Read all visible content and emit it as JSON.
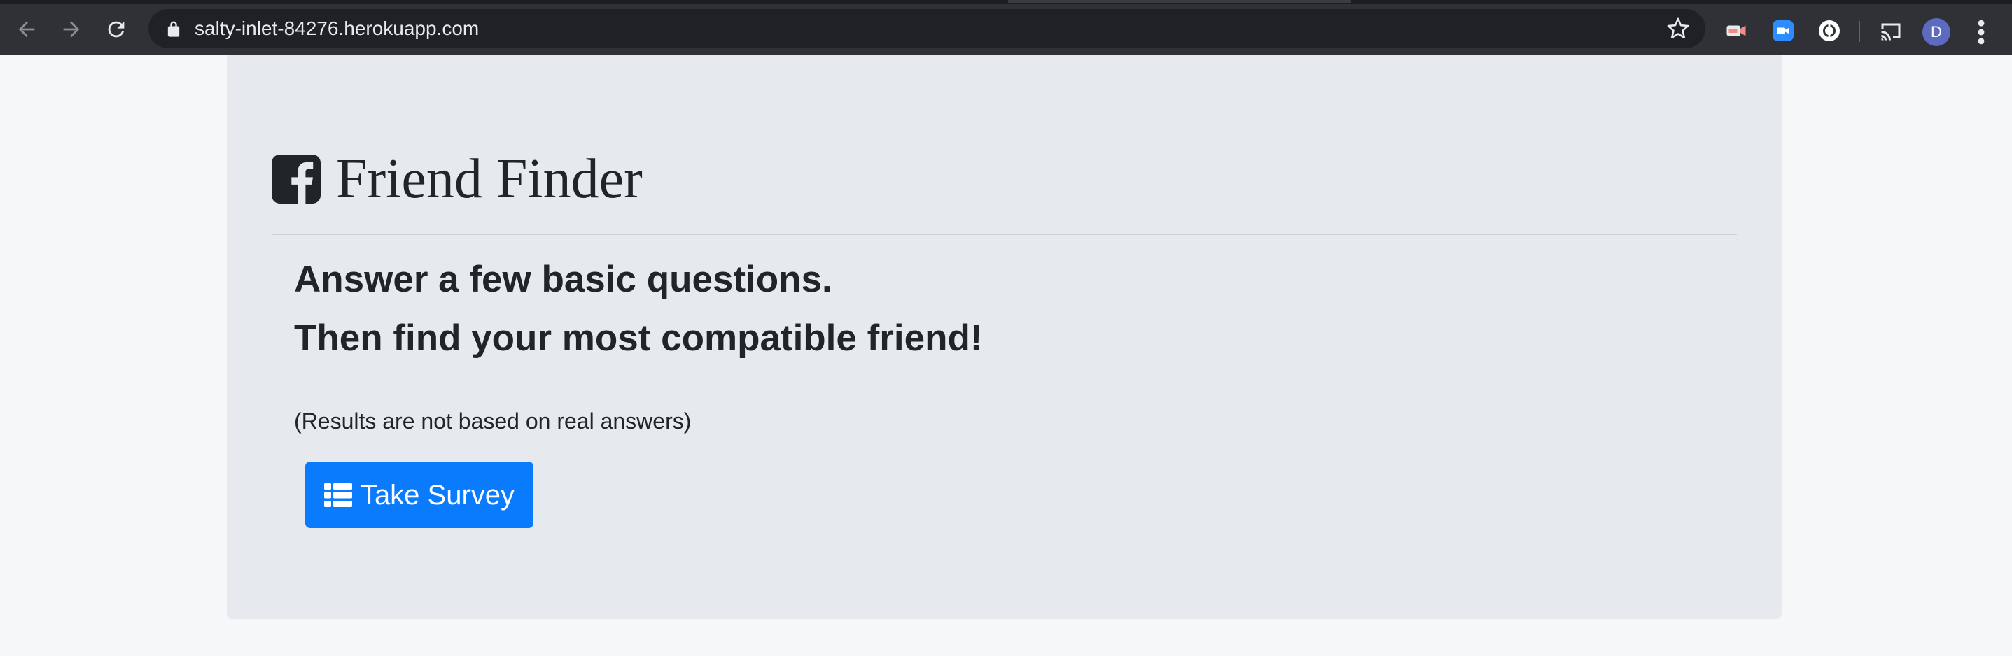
{
  "browser": {
    "url": "salty-inlet-84276.herokuapp.com",
    "avatar_initial": "D",
    "icons": [
      "back-arrow-icon",
      "forward-arrow-icon",
      "reload-icon",
      "lock-icon",
      "bookmark-star-icon",
      "video-extension-icon",
      "zoom-extension-icon",
      "circle-extension-icon",
      "cast-icon",
      "kebab-menu-icon"
    ]
  },
  "page": {
    "brand_title": "Friend Finder",
    "brand_icon": "facebook-square-icon",
    "lead_line1": "Answer a few basic questions.",
    "lead_line2": "Then find your most compatible friend!",
    "note": "(Results are not based on real answers)",
    "button_label": "Take Survey",
    "button_icon": "list-icon"
  },
  "colors": {
    "page_background": "#f6f7f9",
    "jumbotron_background": "#e6e9ed",
    "primary_button": "#0a7bfc",
    "text": "#212529",
    "browser_toolbar": "#2f3136",
    "avatar": "#5c6bc0"
  }
}
